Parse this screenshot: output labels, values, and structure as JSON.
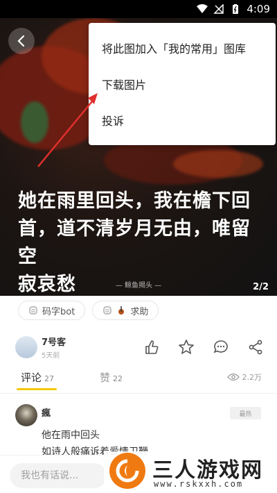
{
  "status_bar": {
    "time": "4:09"
  },
  "photo": {
    "quote_lines": [
      "她在雨里回头，我在檐下回",
      "首，道不清岁月无由，唯留空",
      "寂哀愁"
    ],
    "watermark": "— 鲸鱼揭头 —",
    "page_counter": "2/2"
  },
  "menu": {
    "items": [
      "将此图加入「我的常用」图库",
      "下载图片",
      "投诉"
    ]
  },
  "tags": [
    "码字bot",
    "求助"
  ],
  "author": {
    "name": "7号客",
    "time": "5天前"
  },
  "tabs": {
    "comments_label": "评论",
    "comments_count": "27",
    "likes_label": "赞",
    "likes_count": "22",
    "views": "2.2万"
  },
  "comment": {
    "name": "瘋",
    "badge": "最热",
    "lines": [
      "他在雨中回头",
      "如诗人般痛诉着爱情卫鞭"
    ]
  },
  "input": {
    "placeholder": "我也有话说..."
  },
  "site_logo": {
    "title": "三人游戏网",
    "url": "www.rskxxh.com"
  },
  "colors": {
    "accent": "#f6c700",
    "menu_arrow": "#e0302d",
    "logo_orange": "#f07a12"
  }
}
